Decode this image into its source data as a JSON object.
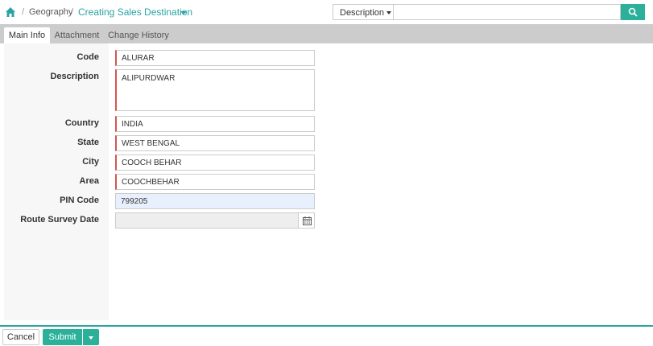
{
  "breadcrumb": {
    "home_icon": "home-icon",
    "items": [
      "Geography"
    ],
    "current": "Creating Sales Destination"
  },
  "search": {
    "dropdown_label": "Description",
    "value": "",
    "placeholder": "",
    "icon": "search-icon"
  },
  "tabs": [
    {
      "label": "Main Info",
      "active": true
    },
    {
      "label": "Attachment",
      "active": false
    },
    {
      "label": "Change History",
      "active": false
    }
  ],
  "form": {
    "code": {
      "label": "Code",
      "value": "ALURAR"
    },
    "description": {
      "label": "Description",
      "value": "ALIPURDWAR"
    },
    "country": {
      "label": "Country",
      "value": "INDIA"
    },
    "state": {
      "label": "State",
      "value": "WEST BENGAL"
    },
    "city": {
      "label": "City",
      "value": "COOCH BEHAR"
    },
    "area": {
      "label": "Area",
      "value": "COOCHBEHAR"
    },
    "pin_code": {
      "label": "PIN Code",
      "value": "799205"
    },
    "route_survey_date": {
      "label": "Route Survey Date",
      "value": "",
      "icon": "calendar-icon"
    }
  },
  "footer": {
    "cancel_label": "Cancel",
    "submit_label": "Submit"
  },
  "colors": {
    "accent": "#2ba3a3",
    "button": "#2bb09a",
    "required": "#d9534f",
    "tab_strip": "#cccccc"
  }
}
